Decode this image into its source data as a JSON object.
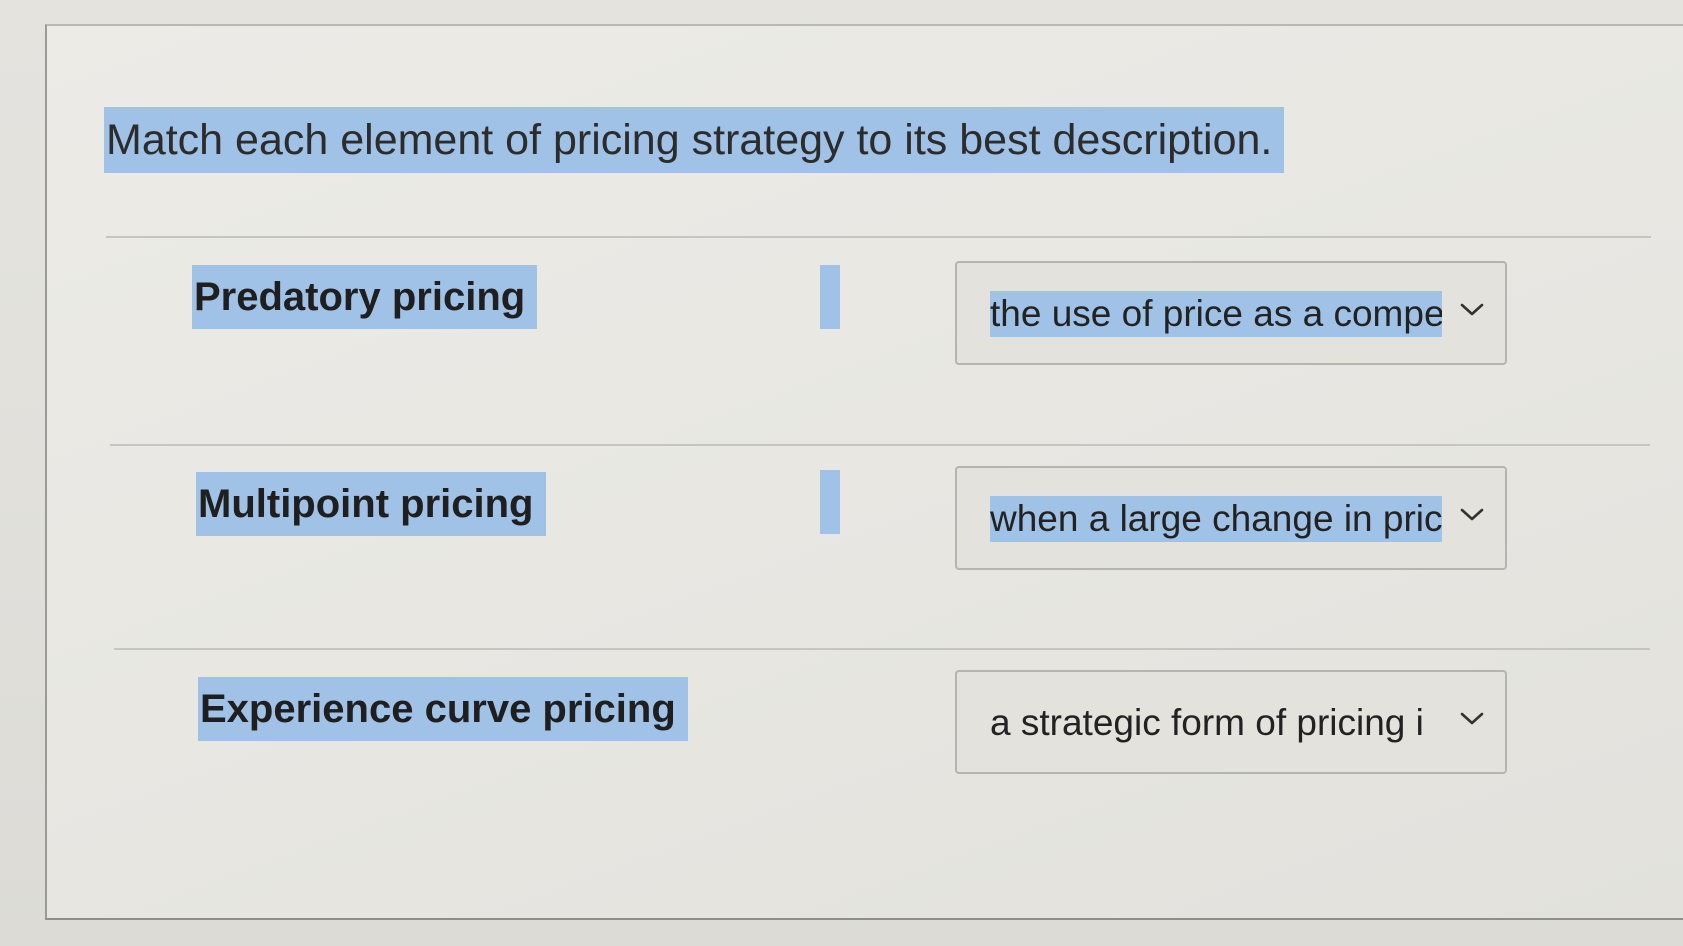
{
  "question": {
    "text": "Match each element of pricing strategy to its best description."
  },
  "items": [
    {
      "term": "Predatory pricing",
      "selected": "the use of price as a compe"
    },
    {
      "term": "Multipoint pricing",
      "selected": "when a large change in pric"
    },
    {
      "term": "Experience curve pricing",
      "selected": "a strategic form of pricing i"
    }
  ],
  "colors": {
    "highlight": "#9fc2e6",
    "panel": "#ecebe6",
    "text": "#222222"
  },
  "icons": {
    "dropdown": "chevron-down-icon"
  }
}
